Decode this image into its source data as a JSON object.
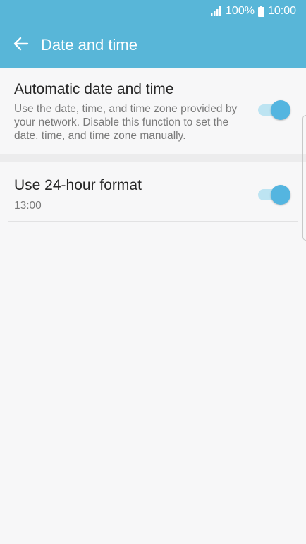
{
  "status_bar": {
    "battery": "100%",
    "time": "10:00",
    "signal_icon": "signal-icon",
    "battery_icon": "battery-icon"
  },
  "app_bar": {
    "title": "Date and time",
    "back_icon": "arrow-left-icon",
    "background": "#58b6d8"
  },
  "settings": [
    {
      "title": "Automatic date and time",
      "subtitle": "Use the date, time, and time zone provided by your network. Disable this function to set the date, time, and time zone manually.",
      "enabled": true
    },
    {
      "title": "Use 24-hour format",
      "subtitle": "13:00",
      "enabled": true
    }
  ],
  "colors": {
    "accent": "#54b5e0",
    "track_on": "#bde4f2"
  }
}
